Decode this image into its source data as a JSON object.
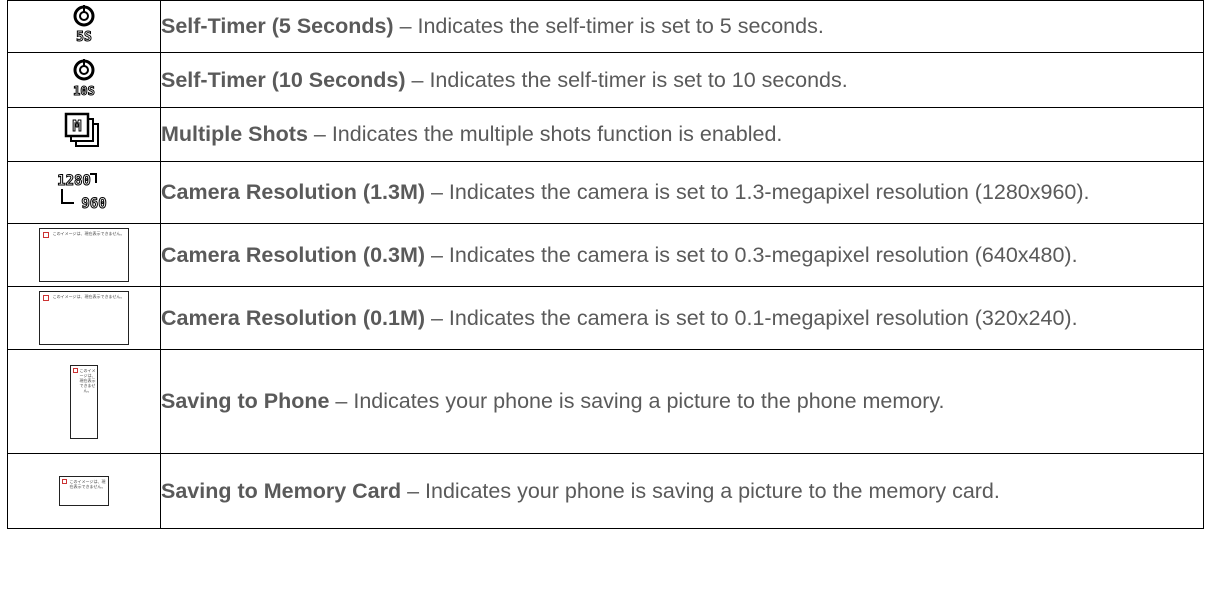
{
  "rows": [
    {
      "icon": "self-timer-5s-icon",
      "title": "Self-Timer (5 Seconds)",
      "desc": " – Indicates the self-timer is set to 5 seconds.",
      "icon_text": "5S"
    },
    {
      "icon": "self-timer-10s-icon",
      "title": "Self-Timer (10 Seconds)",
      "desc": " – Indicates the self-timer is set to 10 seconds.",
      "icon_text": "10S"
    },
    {
      "icon": "multiple-shots-icon",
      "title": "Multiple Shots",
      "desc": " – Indicates the multiple shots function is enabled.",
      "icon_text": "M"
    },
    {
      "icon": "resolution-1280x960-icon",
      "title": "Camera Resolution (1.3M)",
      "desc": " – Indicates the camera is set to 1.3-megapixel resolution (1280x960).",
      "icon_text_top": "1280",
      "icon_text_bottom": "960"
    },
    {
      "icon": "broken-image-icon",
      "title": "Camera Resolution (0.3M)",
      "desc": " – Indicates the camera is set to 0.3-megapixel resolution (640x480).",
      "icon_text": "このイメージは、現在表示できません。"
    },
    {
      "icon": "broken-image-icon",
      "title": "Camera Resolution (0.1M)",
      "desc": " – Indicates the camera is set to 0.1-megapixel resolution (320x240).",
      "icon_text": "このイメージは、現在表示できません。"
    },
    {
      "icon": "broken-image-icon",
      "title": "Saving to Phone",
      "desc": " – Indicates your phone is saving a picture to the phone memory.",
      "icon_text": "このイメージは、現在表示できません。"
    },
    {
      "icon": "broken-image-icon",
      "title": "Saving to Memory Card",
      "desc": " – Indicates your phone is saving a picture to the memory card.",
      "icon_text": "このイメージは、現在表示できません。"
    }
  ]
}
